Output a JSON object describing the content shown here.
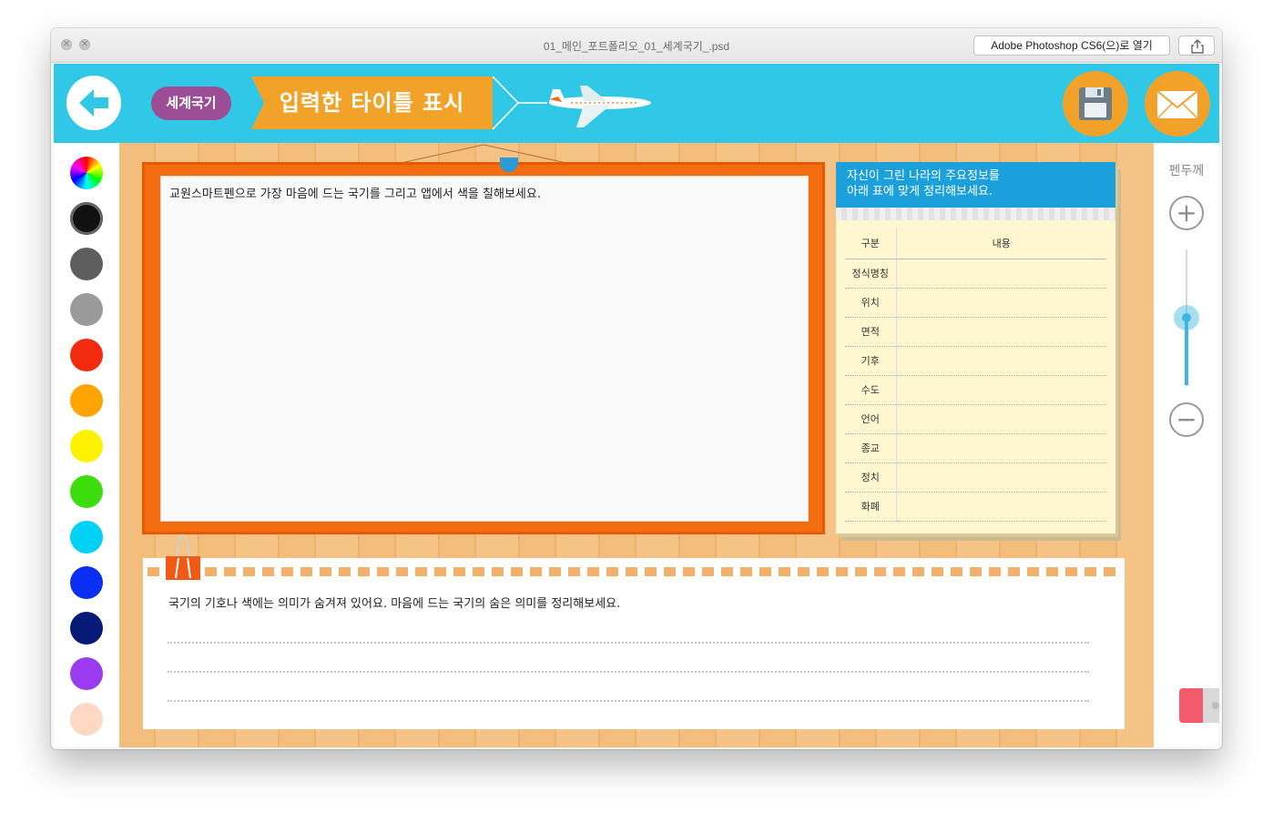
{
  "window": {
    "title": "01_메인_포트폴리오_01_세계국기_.psd",
    "open_with": "Adobe Photoshop CS6(으)로 열기"
  },
  "header": {
    "badge": "세계국기",
    "title": "입력한 타이틀 표시"
  },
  "colors": {
    "header": "#31c8e8",
    "accent_orange": "#f3a229",
    "badge_purple": "#9b4e93",
    "note_blue": "#1ca0dc"
  },
  "palette": [
    {
      "name": "rainbow",
      "color": "conic"
    },
    {
      "name": "black",
      "color": "#111111",
      "selected": true
    },
    {
      "name": "dark-gray",
      "color": "#5e5e5e"
    },
    {
      "name": "gray",
      "color": "#9a9a9a"
    },
    {
      "name": "red",
      "color": "#f22b0f"
    },
    {
      "name": "orange",
      "color": "#ffa400"
    },
    {
      "name": "yellow",
      "color": "#fff200"
    },
    {
      "name": "green",
      "color": "#3ddc0c"
    },
    {
      "name": "cyan",
      "color": "#00d1f5"
    },
    {
      "name": "blue",
      "color": "#0a2ef2"
    },
    {
      "name": "navy",
      "color": "#081a78"
    },
    {
      "name": "purple",
      "color": "#9a3bf0"
    },
    {
      "name": "peach",
      "color": "#ffd8c4"
    }
  ],
  "drawing": {
    "prompt": "교원스마트펜으로 가장 마음에 드는 국기를 그리고 앱에서 색을 칠해보세요."
  },
  "info": {
    "heading_line1": "자신이 그린 나라의 주요정보를",
    "heading_line2": "아래 표에 맞게 정리해보세요.",
    "col1": "구분",
    "col2": "내용",
    "rows": [
      "정식명칭",
      "위치",
      "면적",
      "기후",
      "수도",
      "언어",
      "종교",
      "정치",
      "화폐"
    ]
  },
  "memo": {
    "prompt": "국기의 기호나 색에는 의미가 숨겨져 있어요. 마음에 드는 국기의 숨은 의미를 정리해보세요."
  },
  "pen": {
    "label": "펜두께",
    "thickness_level": 0.5
  }
}
